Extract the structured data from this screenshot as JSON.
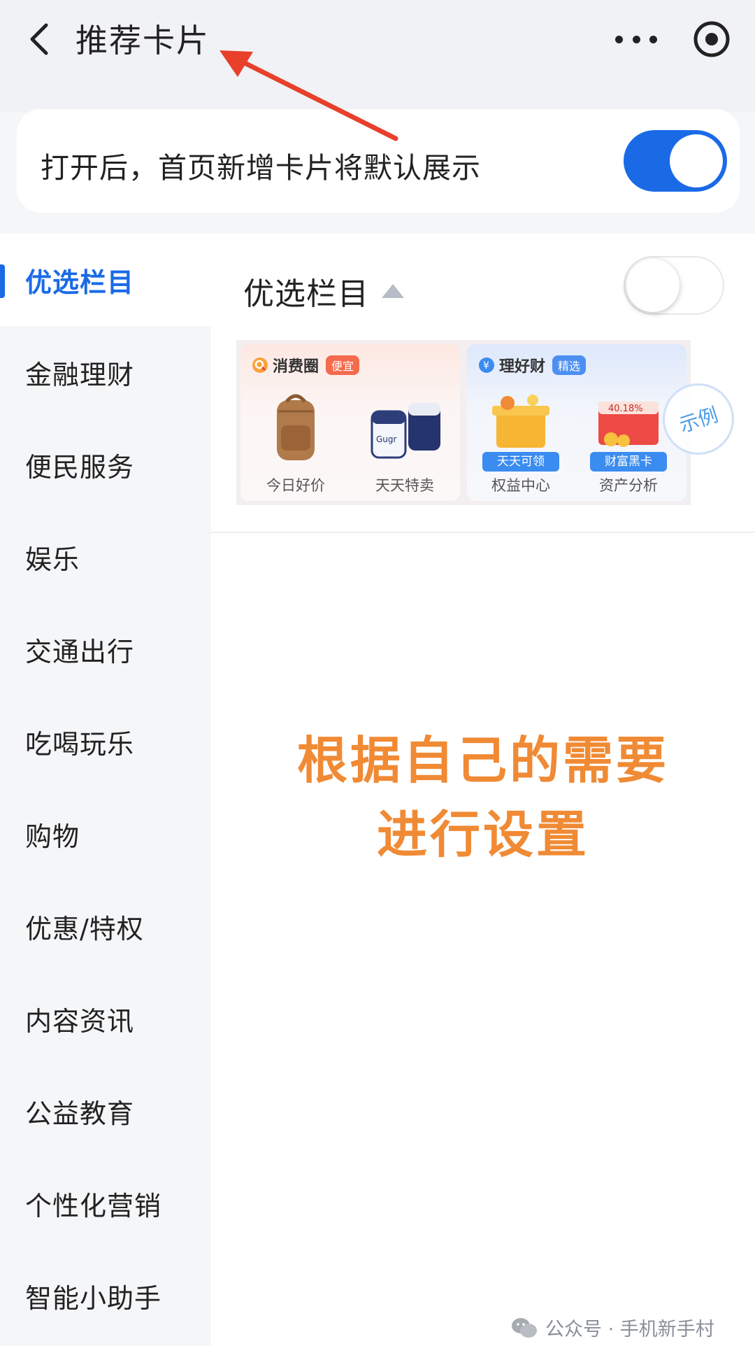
{
  "header": {
    "title": "推荐卡片"
  },
  "toggle_card": {
    "label": "打开后，首页新增卡片将默认展示",
    "enabled": true
  },
  "sidebar": {
    "items": [
      {
        "label": "优选栏目",
        "active": true
      },
      {
        "label": "金融理财"
      },
      {
        "label": "便民服务"
      },
      {
        "label": "娱乐"
      },
      {
        "label": "交通出行"
      },
      {
        "label": "吃喝玩乐"
      },
      {
        "label": "购物"
      },
      {
        "label": "优惠/特权"
      },
      {
        "label": "内容资讯"
      },
      {
        "label": "公益教育"
      },
      {
        "label": "个性化营销"
      },
      {
        "label": "智能小助手"
      }
    ]
  },
  "section": {
    "title": "优选栏目",
    "enabled": false
  },
  "preview": {
    "card1": {
      "title": "消费圈",
      "badge": "便宜",
      "items": [
        "今日好价",
        "天天特卖"
      ]
    },
    "card2": {
      "title": "理好财",
      "badge": "精选",
      "items": [
        "权益中心",
        "资产分析"
      ],
      "tags": [
        "天天可领",
        "财富黑卡"
      ],
      "rate": "40.18%"
    },
    "sample_stamp": "示例",
    "brand_text": "Gugr"
  },
  "overlay": {
    "line1": "根据自己的需要",
    "line2": "进行设置"
  },
  "watermark": {
    "text": "公众号 · 手机新手村"
  },
  "colors": {
    "accent": "#1a6ae6",
    "overlay_text": "#f08a34",
    "arrow": "#e8402b"
  }
}
